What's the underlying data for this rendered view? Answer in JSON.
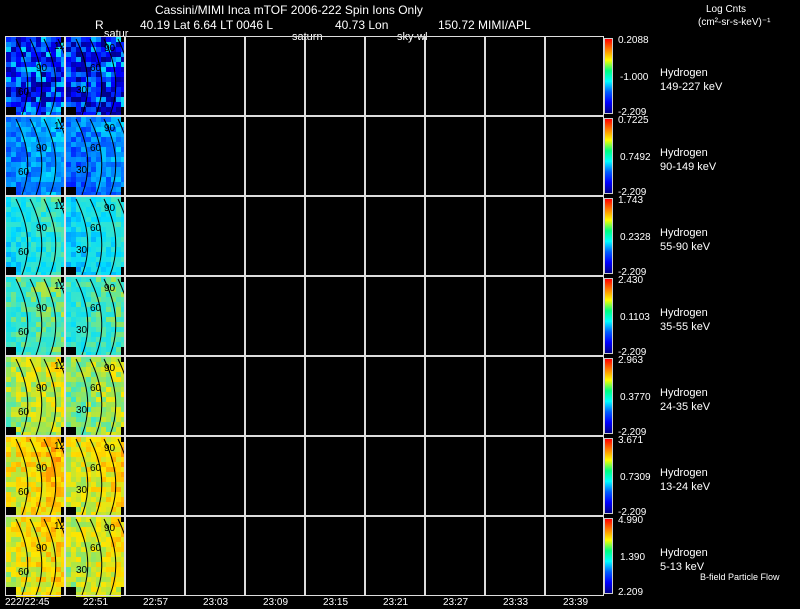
{
  "header": {
    "title": "Cassini/MIMI Inca mTOF  2006-222   Spin    Ions Only",
    "info_R": "R",
    "info_line": "40.19 Lat 6.64 LT 0046 L",
    "info_lon": "40.73 Lon",
    "info_lon_val": "150.72  MIMI/APL",
    "units_title": "Log Cnts",
    "units": "(cm²-sr-s-keV)⁻¹",
    "overlays": [
      "satur",
      "saturn",
      "sky-wl"
    ]
  },
  "rows": [
    {
      "species": "Hydrogen",
      "energy": "149-227 keV",
      "cb_max": "0.2088",
      "cb_mid": "-1.000",
      "cb_min": "-2.209"
    },
    {
      "species": "Hydrogen",
      "energy": "90-149 keV",
      "cb_max": "0.7225",
      "cb_mid": "0.7492",
      "cb_min": "-2.209"
    },
    {
      "species": "Hydrogen",
      "energy": "55-90 keV",
      "cb_max": "1.743",
      "cb_mid": "0.2328",
      "cb_min": "-2.209"
    },
    {
      "species": "Hydrogen",
      "energy": "35-55 keV",
      "cb_max": "2.430",
      "cb_mid": "0.1103",
      "cb_min": "-2.209"
    },
    {
      "species": "Hydrogen",
      "energy": "24-35 keV",
      "cb_max": "2.963",
      "cb_mid": "0.3770",
      "cb_min": "-2.209"
    },
    {
      "species": "Hydrogen",
      "energy": "13-24 keV",
      "cb_max": "3.671",
      "cb_mid": "0.7309",
      "cb_min": "-2.209"
    },
    {
      "species": "Hydrogen",
      "energy": "5-13 keV",
      "cb_max": "4.990",
      "cb_mid": "1.390",
      "cb_min": "2.209"
    }
  ],
  "footer": {
    "bfield_label": "B-field Particle Flow",
    "time_ticks": [
      "222/22:45",
      "22:51",
      "22:57",
      "23:03",
      "23:09",
      "23:15",
      "23:21",
      "23:27",
      "23:33",
      "23:39"
    ]
  },
  "contour_labels": [
    "12",
    "90",
    "60",
    "30"
  ],
  "colors": {
    "background": "#000000",
    "grid": "#dddddd",
    "text": "#ffffff",
    "contour": "#000000"
  },
  "chart_data": {
    "type": "heatmap",
    "title": "Cassini/MIMI Inca mTOF  2006-222   Spin    Ions Only",
    "x_ticks": [
      "222/22:45",
      "22:51",
      "22:57",
      "23:03",
      "23:09",
      "23:15",
      "23:21",
      "23:27",
      "23:33",
      "23:39"
    ],
    "panels_with_data": 2,
    "channels": [
      {
        "energy": "149-227 keV",
        "colorbar": [
          0.2088,
          -1.0,
          -2.209
        ],
        "level": 0.2
      },
      {
        "energy": "90-149 keV",
        "colorbar": [
          0.7225,
          0.7492,
          -2.209
        ],
        "level": 0.32
      },
      {
        "energy": "55-90 keV",
        "colorbar": [
          1.743,
          0.2328,
          -2.209
        ],
        "level": 0.47
      },
      {
        "energy": "35-55 keV",
        "colorbar": [
          2.43,
          0.1103,
          -2.209
        ],
        "level": 0.55
      },
      {
        "energy": "24-35 keV",
        "colorbar": [
          2.963,
          0.377,
          -2.209
        ],
        "level": 0.66
      },
      {
        "energy": "13-24 keV",
        "colorbar": [
          3.671,
          0.7309,
          -2.209
        ],
        "level": 0.74
      },
      {
        "energy": "5-13 keV",
        "colorbar": [
          4.99,
          1.39,
          2.209
        ],
        "level": 0.72
      }
    ]
  }
}
